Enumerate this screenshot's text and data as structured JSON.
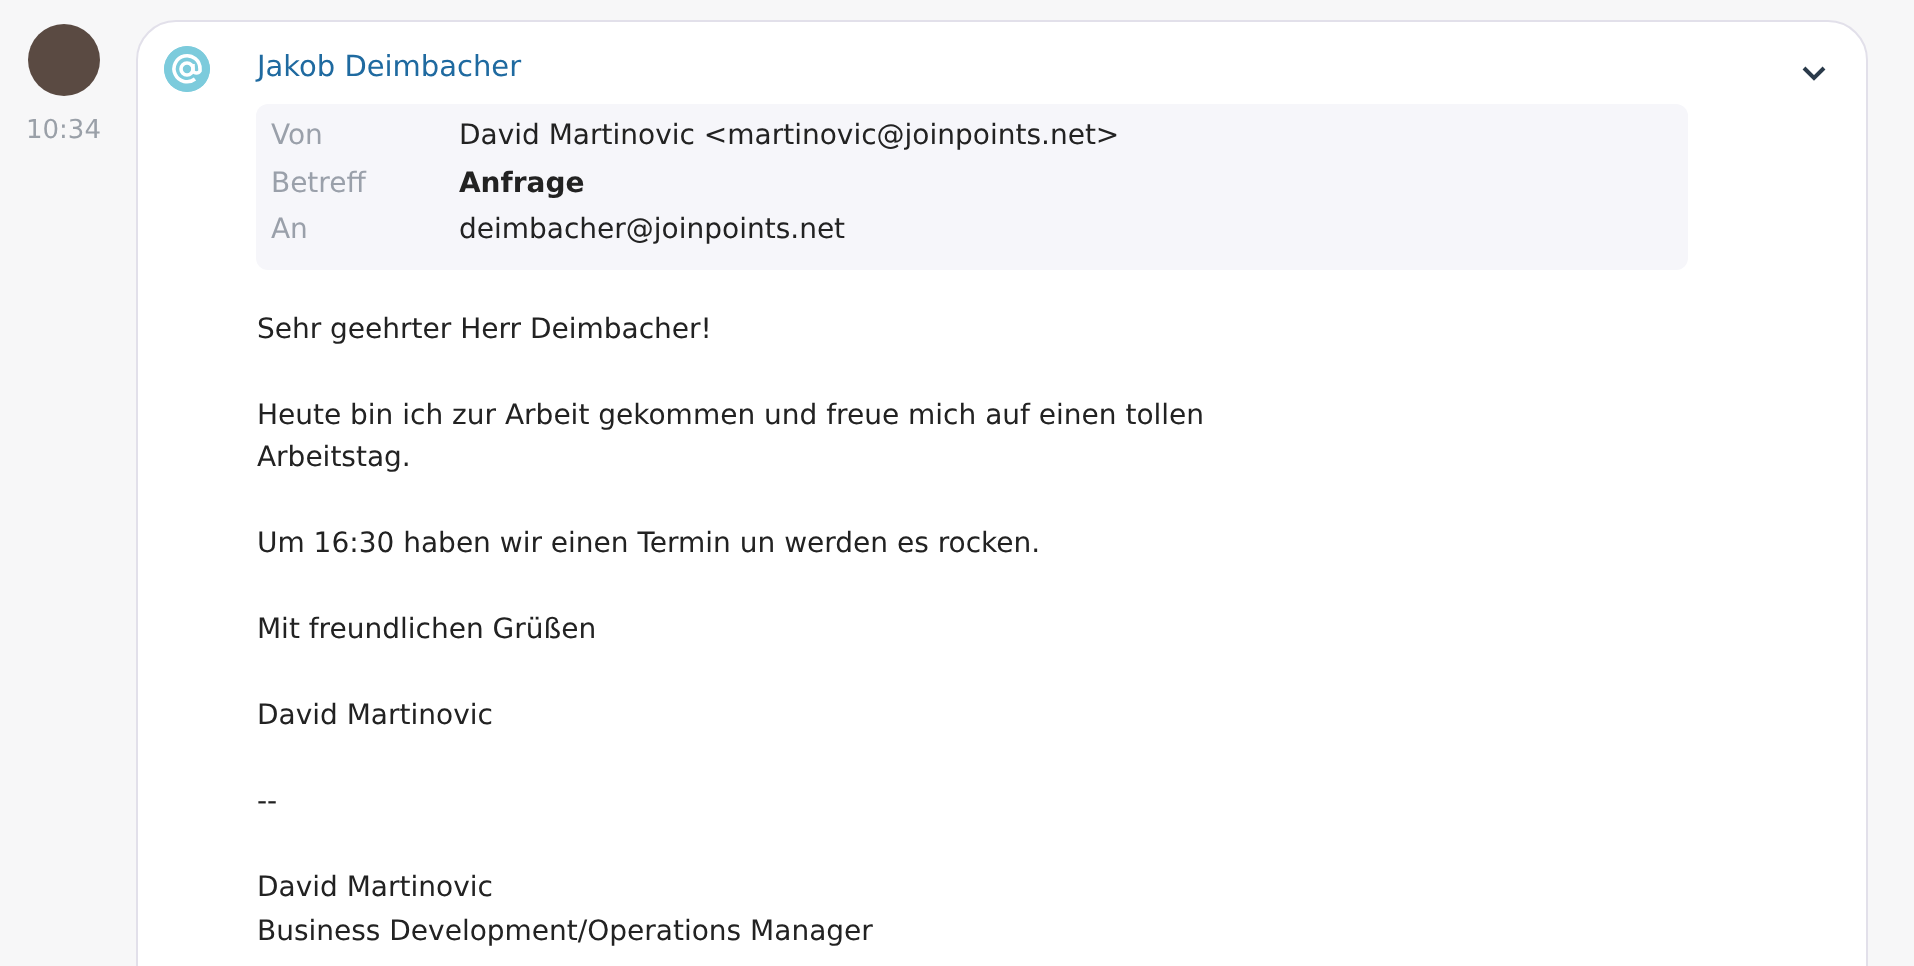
{
  "message": {
    "time": "10:34",
    "sender": "Jakob Deimbacher",
    "expanded": true,
    "header": [
      {
        "label": "Von",
        "value": "David Martinovic <martinovic@joinpoints.net>",
        "bold": false
      },
      {
        "label": "Betreff",
        "value": "Anfrage",
        "bold": true
      },
      {
        "label": "An",
        "value": "deimbacher@joinpoints.net",
        "bold": false
      }
    ],
    "body": [
      [
        "Sehr geehrter Herr Deimbacher!"
      ],
      [
        "Heute bin ich zur Arbeit gekommen und freue mich auf einen tollen",
        "Arbeitstag."
      ],
      [
        "Um 16:30 haben wir einen Termin un werden es rocken."
      ],
      [
        "Mit freundlichen Grüßen"
      ],
      [
        "David Martinovic"
      ],
      [
        "--"
      ],
      [
        "David Martinovic",
        "Business Development/Operations Manager"
      ]
    ]
  }
}
